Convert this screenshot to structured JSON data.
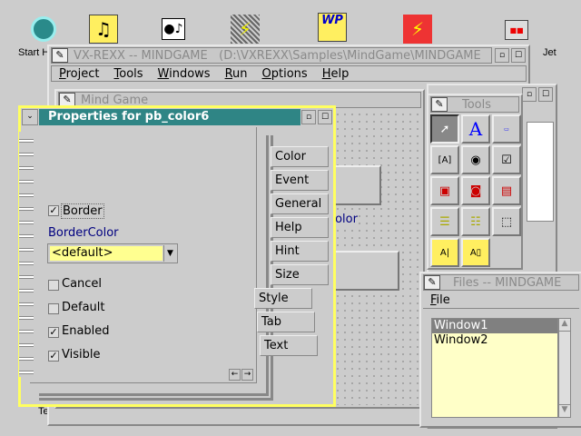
{
  "desktop": {
    "icons": [
      "start-here-icon",
      "multimedia-folder-icon",
      "sound-icon",
      "vxrexx-shadow-icon",
      "wp-folder-icon",
      "vxrexx-icon",
      "printer-icon"
    ],
    "labels": {
      "start": "Start H",
      "printer": "Jet",
      "templates": "Templates"
    }
  },
  "main_window": {
    "title": "VX-REXX -- MINDGAME   (D:\\VXREXX\\Samples\\MindGame\\MINDGAME",
    "menu": [
      "Project",
      "Tools",
      "Windows",
      "Run",
      "Options",
      "Help"
    ]
  },
  "mind_game": {
    "title": "Mind Game",
    "canvas_text": {
      "color": "Color",
      "s": "s"
    }
  },
  "properties": {
    "title": "Properties for pb_color6",
    "tabs_right": [
      "Color",
      "Event",
      "General",
      "Help",
      "Hint",
      "Size"
    ],
    "tabs_bottom": [
      "Style",
      "Tab",
      "Text"
    ],
    "border_label": "Border",
    "border_checked": true,
    "border_color_label": "BorderColor",
    "border_color_value": "<default>",
    "checkboxes": [
      {
        "label": "Cancel",
        "checked": false
      },
      {
        "label": "Default",
        "checked": false
      },
      {
        "label": "Enabled",
        "checked": true
      },
      {
        "label": "Visible",
        "checked": true
      }
    ],
    "page_prev": "←",
    "page_next": "→"
  },
  "tools": {
    "title": "Tools",
    "items": [
      "pointer-tool",
      "text-tool",
      "entry-field-tool",
      "push-button-tool",
      "radio-button-tool",
      "checkbox-tool",
      "picture-button-tool",
      "picture-radio-tool",
      "picture-tool",
      "listbox-tool",
      "combobox-tool",
      "group-box-tool",
      "label-tool",
      "spin-tool"
    ]
  },
  "files": {
    "title": "Files -- MINDGAME",
    "menu": "File",
    "items": [
      "Window1",
      "Window2"
    ],
    "selected": "Window1"
  },
  "colors": {
    "titlebar_active": "#2f8585",
    "accent_blue": "#000080",
    "highlight": "#ffff80"
  }
}
